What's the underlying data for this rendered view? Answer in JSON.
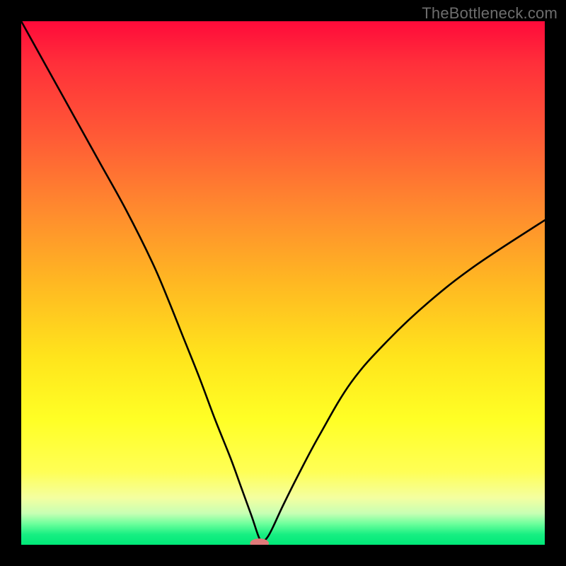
{
  "watermark": "TheBottleneck.com",
  "colors": {
    "frame": "#000000",
    "curve": "#000000",
    "marker": "#e07a7a",
    "gradient_top": "#ff0a3a",
    "gradient_bottom": "#00e878"
  },
  "chart_data": {
    "type": "line",
    "title": "",
    "xlabel": "",
    "ylabel": "",
    "xlim": [
      0,
      100
    ],
    "ylim": [
      0,
      100
    ],
    "grid": false,
    "legend": false,
    "series": [
      {
        "name": "bottleneck-curve",
        "x": [
          0,
          5,
          10,
          15,
          20,
          25,
          28,
          31,
          34,
          37,
          40,
          42,
          44,
          45,
          45.5,
          46,
          47,
          48,
          50,
          53,
          57,
          63,
          70,
          78,
          87,
          100
        ],
        "values": [
          100,
          91,
          82,
          73,
          64,
          54,
          47,
          39.5,
          32,
          24,
          16.5,
          11,
          5.5,
          2.5,
          1.2,
          0.5,
          1.4,
          3.2,
          7.5,
          13.5,
          21,
          31,
          39,
          46.5,
          53.5,
          62
        ]
      }
    ],
    "marker": {
      "x": 45.5,
      "y": 0.3,
      "rx": 1.8,
      "ry": 0.9
    },
    "gradient_stops": [
      {
        "pos": 0.0,
        "color": "#ff0a3a"
      },
      {
        "pos": 0.08,
        "color": "#ff2f3a"
      },
      {
        "pos": 0.22,
        "color": "#ff5a36"
      },
      {
        "pos": 0.36,
        "color": "#ff8a2e"
      },
      {
        "pos": 0.5,
        "color": "#ffb822"
      },
      {
        "pos": 0.64,
        "color": "#ffe41c"
      },
      {
        "pos": 0.76,
        "color": "#ffff25"
      },
      {
        "pos": 0.86,
        "color": "#ffff55"
      },
      {
        "pos": 0.91,
        "color": "#f4ffa0"
      },
      {
        "pos": 0.94,
        "color": "#c8ffb4"
      },
      {
        "pos": 0.96,
        "color": "#6cff9c"
      },
      {
        "pos": 0.98,
        "color": "#18ef82"
      },
      {
        "pos": 1.0,
        "color": "#00e878"
      }
    ]
  }
}
